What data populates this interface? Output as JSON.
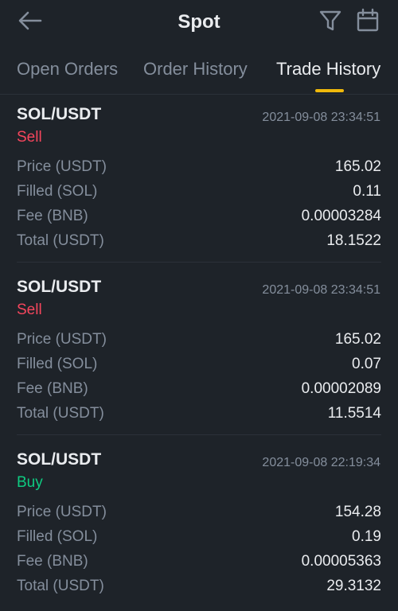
{
  "header": {
    "title": "Spot",
    "back_icon": "arrow-left-icon",
    "filter_icon": "filter-icon",
    "calendar_icon": "calendar-icon"
  },
  "tabs": [
    {
      "label": "Open Orders",
      "active": false
    },
    {
      "label": "Order History",
      "active": false
    },
    {
      "label": "Trade History",
      "active": true
    }
  ],
  "colors": {
    "accent": "#f0b90b",
    "sell": "#f6465d",
    "buy": "#0ecb81",
    "background": "#1e2329",
    "text_primary": "#eaecef",
    "text_secondary": "#848e9c"
  },
  "trades": [
    {
      "pair": "SOL/USDT",
      "side": "Sell",
      "time": "2021-09-08 23:34:51",
      "rows": [
        {
          "label": "Price (USDT)",
          "value": "165.02"
        },
        {
          "label": "Filled (SOL)",
          "value": "0.11"
        },
        {
          "label": "Fee (BNB)",
          "value": "0.00003284"
        },
        {
          "label": "Total (USDT)",
          "value": "18.1522"
        }
      ]
    },
    {
      "pair": "SOL/USDT",
      "side": "Sell",
      "time": "2021-09-08 23:34:51",
      "rows": [
        {
          "label": "Price (USDT)",
          "value": "165.02"
        },
        {
          "label": "Filled (SOL)",
          "value": "0.07"
        },
        {
          "label": "Fee (BNB)",
          "value": "0.00002089"
        },
        {
          "label": "Total (USDT)",
          "value": "11.5514"
        }
      ]
    },
    {
      "pair": "SOL/USDT",
      "side": "Buy",
      "time": "2021-09-08 22:19:34",
      "rows": [
        {
          "label": "Price (USDT)",
          "value": "154.28"
        },
        {
          "label": "Filled (SOL)",
          "value": "0.19"
        },
        {
          "label": "Fee (BNB)",
          "value": "0.00005363"
        },
        {
          "label": "Total (USDT)",
          "value": "29.3132"
        }
      ]
    }
  ]
}
